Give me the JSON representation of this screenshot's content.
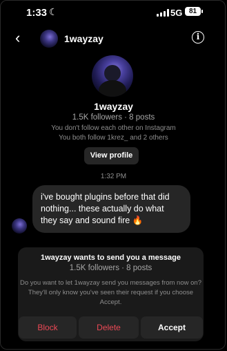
{
  "status_bar": {
    "time": "1:33",
    "network": "5G",
    "battery": "81"
  },
  "header": {
    "username": "1wayzay"
  },
  "profile": {
    "name": "1wayzay",
    "stats": "1.5K followers · 8 posts",
    "follow_status": "You don't follow each other on Instagram",
    "mutuals": "You both follow 1krez_ and 2 others",
    "view_profile_label": "View profile"
  },
  "thread": {
    "timestamp": "1:32 PM",
    "message": "i've bought plugins before that did nothing... these actually do what they say and sound fire 🔥"
  },
  "request": {
    "title": "1wayzay wants to send you a message",
    "stats": "1.5K followers · 8 posts",
    "body": "Do you want to let 1wayzay send you messages from now on? They'll only know you've seen their request if you choose Accept.",
    "block_label": "Block",
    "delete_label": "Delete",
    "accept_label": "Accept"
  }
}
